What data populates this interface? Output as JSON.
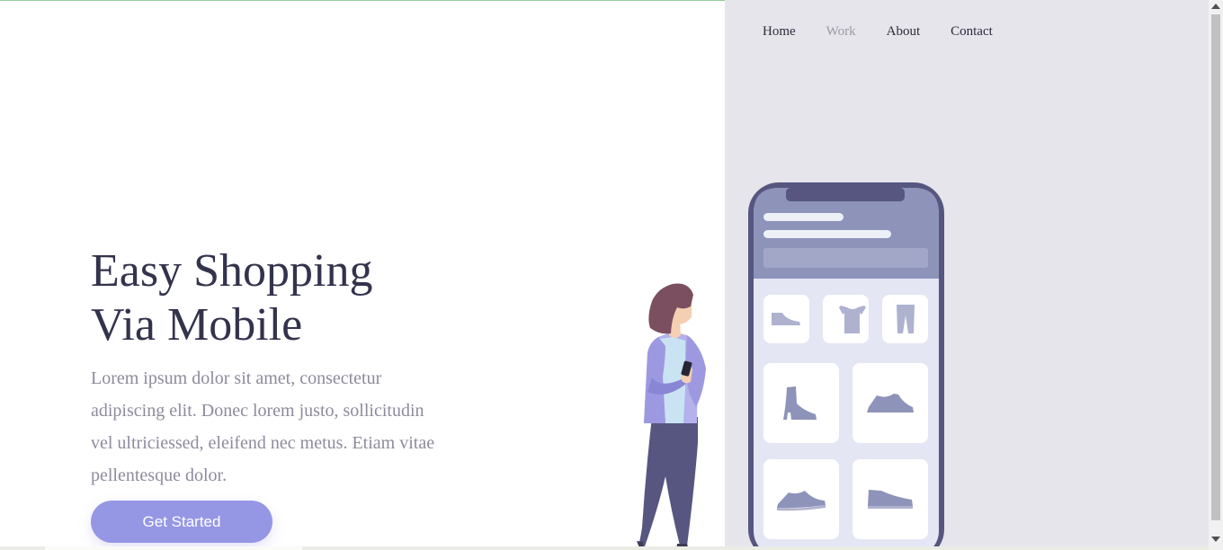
{
  "nav": {
    "items": [
      {
        "label": "Home",
        "muted": false
      },
      {
        "label": "Work",
        "muted": true
      },
      {
        "label": "About",
        "muted": false
      },
      {
        "label": "Contact",
        "muted": false
      }
    ]
  },
  "hero": {
    "title_line1": "Easy Shopping",
    "title_line2": "Via Mobile",
    "body_lines": [
      "Lorem ipsum dolor sit amet, consectetur",
      "adipiscing elit. Donec lorem justo, sollicitudin",
      "vel ultriciessed, eleifend nec metus. Etiam vitae",
      "pellentesque dolor."
    ],
    "cta_label": "Get Started"
  },
  "colors": {
    "accent": "#9597e5",
    "panel_bg": "#e6e5eb",
    "heading": "#33334d",
    "body_text": "#8d8b9c",
    "phone_frame": "#565680"
  },
  "illustration": {
    "icons": [
      "sneaker-icon",
      "tshirt-icon",
      "pants-icon",
      "boot-icon",
      "shoe-icon",
      "shoe-icon",
      "shoe-icon"
    ]
  }
}
